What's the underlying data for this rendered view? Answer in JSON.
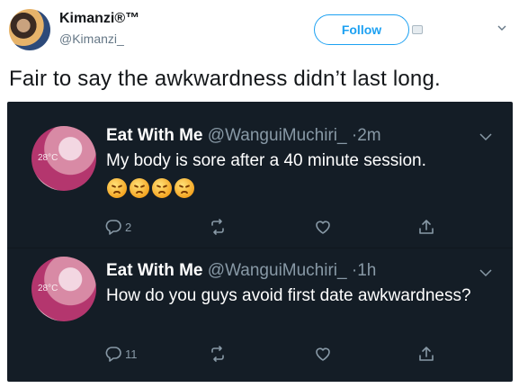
{
  "outer_tweet": {
    "name": "Kimanzi®™",
    "handle": "@Kimanzi_",
    "follow_label": "Follow",
    "text": "Fair to say the awkwardness didn’t last long."
  },
  "embedded_tweets": [
    {
      "name": "Eat With Me",
      "handle": "@WanguiMuchiri_",
      "dot": "·",
      "time": "2m",
      "text": "My body is sore after a 40 minute session.",
      "avatar_overlay": "28°C",
      "emojis": [
        "persevering-face",
        "persevering-face",
        "persevering-face",
        "persevering-face"
      ],
      "reply_count": "2"
    },
    {
      "name": "Eat With Me",
      "handle": "@WanguiMuchiri_",
      "dot": "·",
      "time": "1h",
      "text": "How do you guys avoid first date awkwardness?",
      "avatar_overlay": "28°C",
      "reply_count": "11"
    }
  ],
  "colors": {
    "accent": "#1da1f2",
    "dark_bg": "#141d26",
    "muted": "#8899a6"
  }
}
